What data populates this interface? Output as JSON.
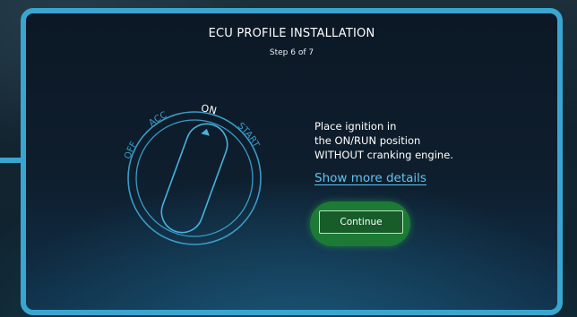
{
  "header": {
    "title": "ECU PROFILE INSTALLATION",
    "step": "Step 6 of 7"
  },
  "ignition": {
    "positions": {
      "off": "OFF",
      "acc": "ACC",
      "on": "ON",
      "start": "START"
    },
    "selected": "ON"
  },
  "instructions": {
    "line1": "Place ignition in",
    "line2": "the ON/RUN position",
    "line3": "WITHOUT cranking engine."
  },
  "details_link": "Show more details",
  "continue_label": "Continue",
  "colors": {
    "accent": "#3aa6d0",
    "link": "#62c3ef",
    "button": "#175c29",
    "button_glow": "#1d7a35"
  }
}
